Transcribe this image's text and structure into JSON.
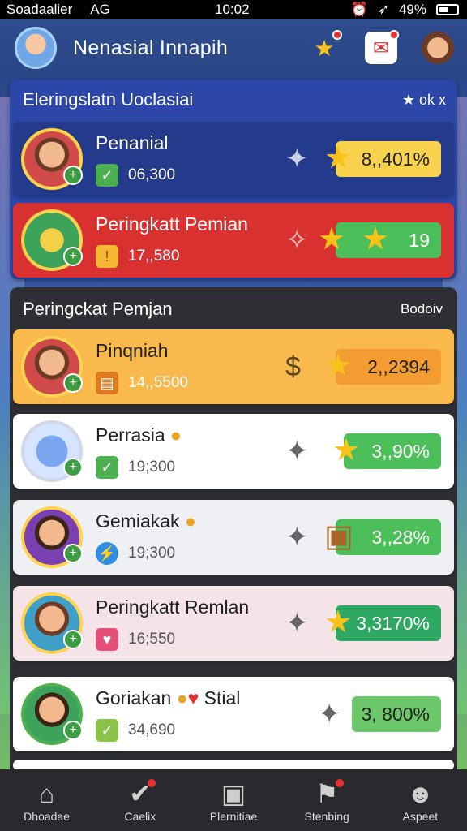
{
  "status_bar": {
    "carrier": "Soadaalier",
    "network": "AG",
    "time": "10:02",
    "battery": "49%"
  },
  "header": {
    "title": "Nenasial Innapih"
  },
  "featured": {
    "title": "Eleringslatn Uoclasiai",
    "right_label": "★ ok x",
    "cards": [
      {
        "name": "Penanial",
        "sub_value": "06,300",
        "score": "8,,401%"
      },
      {
        "name": "Peringkatt Pemian",
        "sub_value": "17,,580",
        "score": "19"
      }
    ]
  },
  "list": {
    "title": "Peringckat Pemjan",
    "right_label": "Bodoiv",
    "items": [
      {
        "name": "Pinqniah",
        "sub_value": "14,,5500",
        "score": "2,,2394"
      },
      {
        "name": "Perrasia",
        "sub_value": "19;300",
        "score": "3,,90%"
      },
      {
        "name": "Gemiakak",
        "sub_value": "19;300",
        "score": "3,,28%"
      },
      {
        "name": "Peringkatt Remlan",
        "sub_value": "16;550",
        "score": "3,3170%"
      },
      {
        "name": "Goriakan",
        "name_extra": "Stial",
        "sub_value": "34,690",
        "score": "3, 800%"
      }
    ]
  },
  "nav": [
    {
      "label": "Dhoadae",
      "icon": "home-icon"
    },
    {
      "label": "Caelix",
      "icon": "check-badge-icon"
    },
    {
      "label": "Plernitiae",
      "icon": "card-icon"
    },
    {
      "label": "Stenbing",
      "icon": "flag-icon"
    },
    {
      "label": "Aspeet",
      "icon": "profile-icon"
    }
  ],
  "colors": {
    "header": "#2e4c8f",
    "featured_panel": "#2c47a8",
    "card_navy": "#243a8a",
    "card_red": "#d93030",
    "card_orange": "#f9b94c",
    "score_yellow": "#f8d24c",
    "score_green": "#4cbe5a",
    "score_orange": "#f39c32"
  }
}
